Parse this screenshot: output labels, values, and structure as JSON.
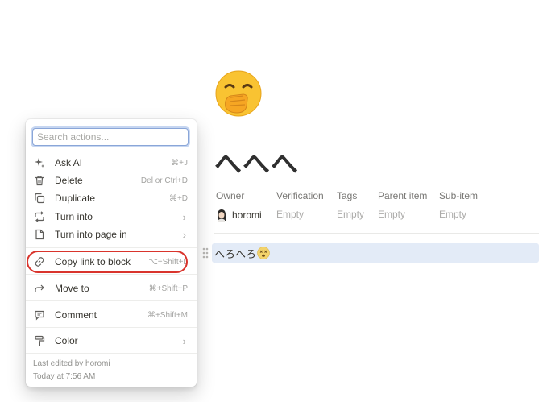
{
  "page": {
    "icon": "hand-over-mouth-emoji",
    "title": "へへへ",
    "properties": [
      {
        "name": "Owner",
        "value": "horomi"
      },
      {
        "name": "Verification",
        "value": "Empty"
      },
      {
        "name": "Tags",
        "value": "Empty"
      },
      {
        "name": "Parent item",
        "value": "Empty"
      },
      {
        "name": "Sub-item",
        "value": "Empty"
      }
    ],
    "block_text": "へろへろ",
    "block_emoji": "dizzy-face-emoji"
  },
  "menu": {
    "search_placeholder": "Search actions...",
    "items": [
      {
        "label": "Ask AI",
        "shortcut": "⌘+J",
        "icon": "sparkle-icon"
      },
      {
        "label": "Delete",
        "shortcut": "Del or Ctrl+D",
        "icon": "trash-icon"
      },
      {
        "label": "Duplicate",
        "shortcut": "⌘+D",
        "icon": "duplicate-icon"
      },
      {
        "label": "Turn into",
        "shortcut": "",
        "icon": "turn-into-icon"
      },
      {
        "label": "Turn into page in",
        "shortcut": "",
        "icon": "page-icon"
      },
      {
        "label": "Copy link to block",
        "shortcut": "⌥+Shift+L",
        "icon": "link-icon"
      },
      {
        "label": "Move to",
        "shortcut": "⌘+Shift+P",
        "icon": "move-arrow-icon"
      },
      {
        "label": "Comment",
        "shortcut": "⌘+Shift+M",
        "icon": "comment-icon"
      },
      {
        "label": "Color",
        "shortcut": "",
        "icon": "paint-roller-icon"
      }
    ],
    "footer": {
      "edited_by": "Last edited by horomi",
      "edited_at": "Today at 7:56 AM"
    }
  },
  "colors": {
    "selection_bg": "#e3ebf7",
    "highlight_ring": "#d9342c",
    "search_focus": "#8aa6d8"
  }
}
